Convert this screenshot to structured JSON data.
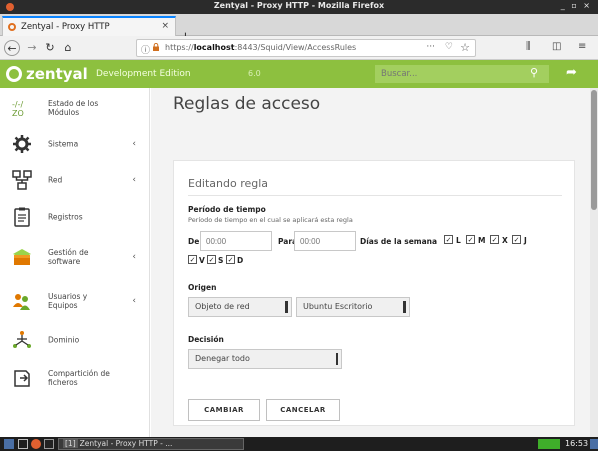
{
  "os": {
    "window_title": "Zentyal - Proxy HTTP - Mozilla Firefox",
    "window_controls": "_ ▫ ×"
  },
  "browser": {
    "tab_title": "Zentyal - Proxy HTTP",
    "tab_close": "×",
    "new_tab": "+",
    "url_prefix": "https://",
    "url_host": "localhost",
    "url_rest": ":8443/Squid/View/AccessRules",
    "icons": [
      "back-icon",
      "forward-icon",
      "reload-icon",
      "home-icon",
      "info-icon",
      "lock-icon",
      "more-icon",
      "pocket-icon",
      "star-icon",
      "library-icon",
      "sidebar-icon",
      "menu-icon"
    ]
  },
  "header": {
    "logo": "zentyal",
    "edition": "Development Edition",
    "version": "6.0",
    "search_placeholder": "Buscar...",
    "brand_color": "#8dc03f"
  },
  "sidebar": {
    "items": [
      {
        "label": "Estado de los Módulos",
        "icon": "modules-status-icon",
        "chevron": ""
      },
      {
        "label": "Sistema",
        "icon": "gear-icon",
        "chevron": "‹"
      },
      {
        "label": "Red",
        "icon": "network-icon",
        "chevron": "‹"
      },
      {
        "label": "Registros",
        "icon": "logs-icon",
        "chevron": ""
      },
      {
        "label": "Gestión de software",
        "icon": "package-icon",
        "chevron": "‹"
      },
      {
        "label": "Usuarios y Equipos",
        "icon": "users-icon",
        "chevron": "‹"
      },
      {
        "label": "Dominio",
        "icon": "domain-icon",
        "chevron": ""
      },
      {
        "label": "Compartición de ficheros",
        "icon": "file-share-icon",
        "chevron": ""
      }
    ]
  },
  "main": {
    "page_title": "Reglas de acceso",
    "form": {
      "title": "Editando regla",
      "period_label": "Período de tiempo",
      "period_help": "Período de tiempo en el cual se aplicará esta regla",
      "from_label": "De",
      "from_placeholder": "00:00",
      "to_label": "Para",
      "to_placeholder": "00:00",
      "days_label": "Días de la semana",
      "days": [
        {
          "letter": "L",
          "checked": true
        },
        {
          "letter": "M",
          "checked": true
        },
        {
          "letter": "X",
          "checked": true
        },
        {
          "letter": "J",
          "checked": true
        },
        {
          "letter": "V",
          "checked": true
        },
        {
          "letter": "S",
          "checked": true
        },
        {
          "letter": "D",
          "checked": true
        }
      ],
      "check_mark": "✓",
      "origin_label": "Origen",
      "origin_type": "Objeto de red",
      "origin_value": "Ubuntu Escritorio",
      "decision_label": "Decisión",
      "decision_value": "Denegar todo",
      "change_button": "CAMBIAR",
      "cancel_button": "CANCELAR"
    }
  },
  "taskbar": {
    "window_number": "[1]",
    "window_label": "Zentyal - Proxy HTTP - ...",
    "clock": "16:53"
  }
}
